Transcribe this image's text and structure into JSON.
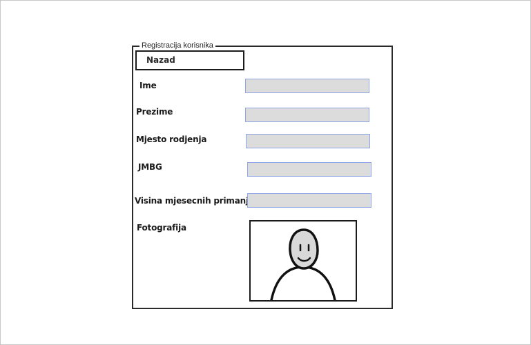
{
  "form": {
    "title": "Registracija korisnika",
    "back_label": "Nazad",
    "fields": [
      {
        "label": "Ime",
        "value": ""
      },
      {
        "label": "Prezime",
        "value": ""
      },
      {
        "label": "Mjesto rodjenja",
        "value": ""
      },
      {
        "label": "JMBG",
        "value": ""
      },
      {
        "label": "Visina mjesecnih primanja",
        "value": ""
      }
    ],
    "photo_label": "Fotografija",
    "photo_icon": "person-placeholder-icon"
  },
  "colors": {
    "input_fill": "#dcdcdc",
    "input_border": "#8fa6e6",
    "frame": "#2a2a2a"
  }
}
